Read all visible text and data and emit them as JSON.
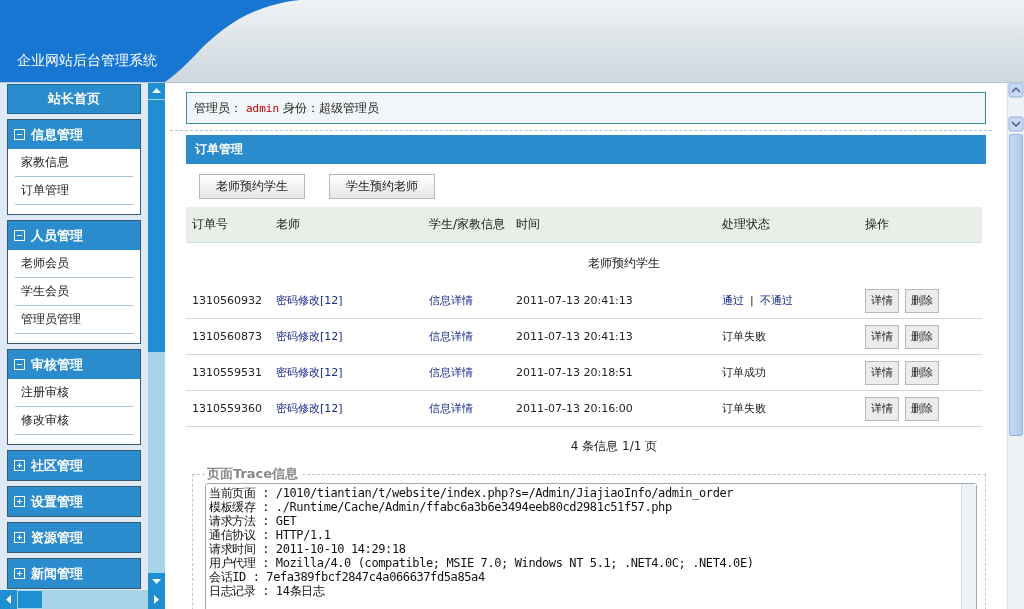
{
  "header": {
    "title": "企业网站后台管理系统"
  },
  "sidebar": {
    "home": "站长首页",
    "groups": [
      {
        "title": "信息管理",
        "expanded": true,
        "items": [
          "家教信息",
          "订单管理"
        ]
      },
      {
        "title": "人员管理",
        "expanded": true,
        "items": [
          "老师会员",
          "学生会员",
          "管理员管理"
        ]
      },
      {
        "title": "审核管理",
        "expanded": true,
        "items": [
          "注册审核",
          "修改审核"
        ]
      },
      {
        "title": "社区管理",
        "expanded": false
      },
      {
        "title": "设置管理",
        "expanded": false
      },
      {
        "title": "资源管理",
        "expanded": false
      },
      {
        "title": "新闻管理",
        "expanded": false
      }
    ]
  },
  "admin_bar": {
    "label": "管理员：",
    "user": "admin",
    "role": "身份：超级管理员"
  },
  "panel": {
    "title": "订单管理",
    "tabs": [
      "老师预约学生",
      "学生预约老师"
    ],
    "table": {
      "columns": [
        "订单号",
        "老师",
        "学生/家教信息",
        "时间",
        "处理状态",
        "操作"
      ],
      "caption": "老师预约学生",
      "rows": [
        {
          "order_no": "1310560932",
          "teacher": "密码修改[12]",
          "info": "信息详情",
          "time": "2011-07-13 20:41:13",
          "status": {
            "kind": "review",
            "approve": "通过",
            "separator": "|",
            "reject": "不通过"
          },
          "actions": [
            "详情",
            "删除"
          ]
        },
        {
          "order_no": "1310560873",
          "teacher": "密码修改[12]",
          "info": "信息详情",
          "time": "2011-07-13 20:41:13",
          "status": {
            "kind": "text",
            "text": "订单失败"
          },
          "actions": [
            "详情",
            "删除"
          ]
        },
        {
          "order_no": "1310559531",
          "teacher": "密码修改[12]",
          "info": "信息详情",
          "time": "2011-07-13 20:18:51",
          "status": {
            "kind": "text",
            "text": "订单成功"
          },
          "actions": [
            "详情",
            "删除"
          ]
        },
        {
          "order_no": "1310559360",
          "teacher": "密码修改[12]",
          "info": "信息详情",
          "time": "2011-07-13 20:16:00",
          "status": {
            "kind": "text",
            "text": "订单失败"
          },
          "actions": [
            "详情",
            "删除"
          ]
        }
      ]
    },
    "pagination": "4 条信息 1/1 页"
  },
  "trace": {
    "legend": "页面Trace信息",
    "lines": [
      "当前页面 : /1010/tiantian/t/website/index.php?s=/Admin/JiajiaoInfo/admin_order",
      "模板缓存 : ./Runtime/Cache/Admin/ffabc6a3b6e3494eeb80cd2981c51f57.php",
      "请求方法 : GET",
      "通信协议 : HTTP/1.1",
      "请求时间 : 2011-10-10 14:29:18",
      "用户代理 : Mozilla/4.0 (compatible; MSIE 7.0; Windows NT 5.1; .NET4.0C; .NET4.0E)",
      "会话ID : 7efa389fbcf2847c4a066637fd5a85a4",
      "日志记录 : 14条日志"
    ]
  }
}
